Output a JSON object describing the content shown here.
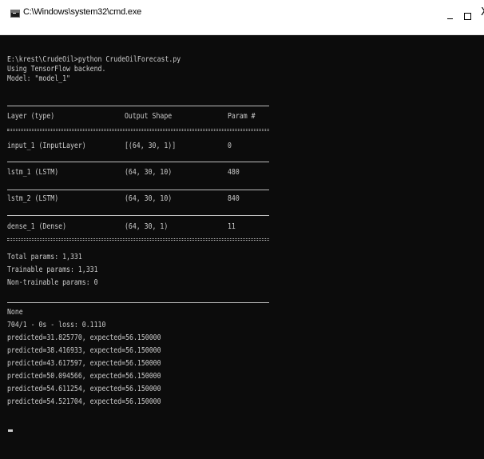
{
  "window": {
    "title": "C:\\Windows\\system32\\cmd.exe",
    "controls": {
      "minimize": "–",
      "maximize": "□",
      "close": "X"
    }
  },
  "console": {
    "header_lines": [
      "E:\\krest\\CrudeOil>python CrudeOilForecast.py",
      "Using TensorFlow backend.",
      "Model: \"model_1\""
    ],
    "summary": {
      "columns": [
        "Layer (type)",
        "Output Shape",
        "Param #"
      ],
      "rows": [
        {
          "layer": "input_1 (InputLayer)",
          "shape": "[(64, 30, 1)]",
          "params": "0"
        },
        {
          "layer": "lstm_1 (LSTM)",
          "shape": "(64, 30, 10)",
          "params": "480"
        },
        {
          "layer": "lstm_2 (LSTM)",
          "shape": "(64, 30, 10)",
          "params": "840"
        },
        {
          "layer": "dense_1 (Dense)",
          "shape": "(64, 30, 1)",
          "params": "11"
        }
      ],
      "totals": [
        "Total params: 1,331",
        "Trainable params: 1,331",
        "Non-trainable params: 0"
      ]
    },
    "output_lines": [
      "None",
      "704/1 - 0s - loss: 0.1110",
      "predicted=31.825770, expected=56.150000",
      "predicted=38.416933, expected=56.150000",
      "predicted=43.617597, expected=56.150000",
      "predicted=50.094566, expected=56.150000",
      "predicted=54.611254, expected=56.150000",
      "predicted=54.521704, expected=56.150000"
    ]
  }
}
